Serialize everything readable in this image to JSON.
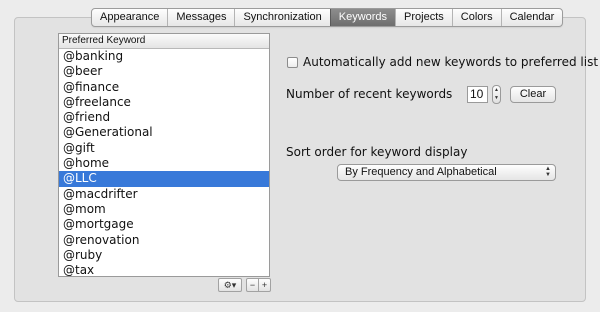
{
  "tabs": [
    {
      "label": "Appearance",
      "active": false
    },
    {
      "label": "Messages",
      "active": false
    },
    {
      "label": "Synchronization",
      "active": false
    },
    {
      "label": "Keywords",
      "active": true
    },
    {
      "label": "Projects",
      "active": false
    },
    {
      "label": "Colors",
      "active": false
    },
    {
      "label": "Calendar",
      "active": false
    }
  ],
  "keyword_list": {
    "header": "Preferred Keyword",
    "items": [
      "@banking",
      "@beer",
      "@finance",
      "@freelance",
      "@friend",
      "@Generational",
      "@gift",
      "@home",
      "@LLC",
      "@macdrifter",
      "@mom",
      "@mortgage",
      "@renovation",
      "@ruby",
      "@tax"
    ],
    "selected": "@LLC",
    "tools": {
      "gear": "⚙▾",
      "remove": "−",
      "add": "+"
    }
  },
  "options": {
    "auto_add_label": "Automatically add new keywords to preferred list",
    "auto_add_checked": false,
    "recent_label": "Number of recent keywords",
    "recent_value": "10",
    "clear_label": "Clear",
    "sort_label": "Sort order for keyword display",
    "sort_value": "By Frequency and Alphabetical"
  }
}
